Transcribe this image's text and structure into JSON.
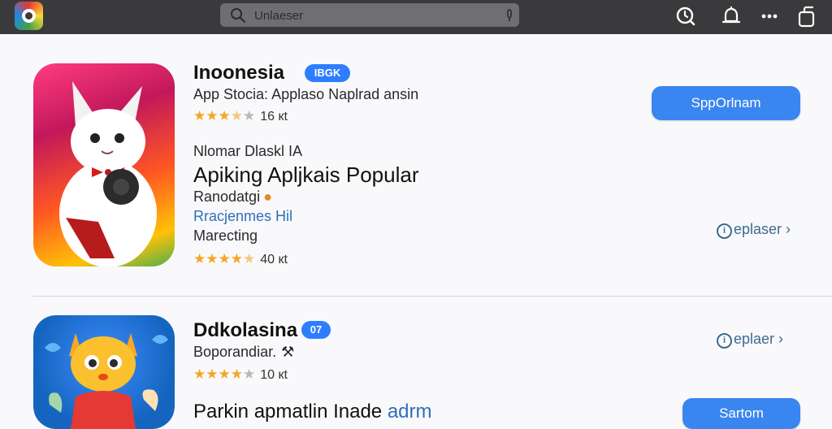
{
  "topbar": {
    "search_placeholder": "Unlaeser",
    "icons": [
      "app-logo",
      "search-icon",
      "mic-icon",
      "history-icon",
      "bell-icon",
      "more-icon",
      "share-icon"
    ]
  },
  "apps": [
    {
      "name": "Inoonesia",
      "badge": "IBGK",
      "subtitle": "App Stocia: Applaso Naplrad ansin",
      "rating": 3.5,
      "rating_count": "16 кt",
      "action_label": "SppOrlnam",
      "section_label": "Nlomar Dlaskl IA",
      "section_title": "Apiking Apljkais Popular",
      "detail_1": "Ranodatgi",
      "detail_link": "Rracjenmes Hil",
      "detail_2": "Marecting",
      "detail_rating": 4.5,
      "detail_rating_count": "40 кt",
      "more_label": "eplaser",
      "icon": "white-cat-mascot-icon"
    },
    {
      "name": "Ddkolasina",
      "badge": "07",
      "subtitle": "Boporandiar.",
      "rating": 4,
      "rating_count": "10 кt",
      "action_label": "Sartom",
      "more_label": "eplaer",
      "section_title": "Parkin apmatlin Inade",
      "section_link": "adrm",
      "icon": "yellow-cat-mascot-icon"
    }
  ],
  "colors": {
    "topbar": "#3a3a3c",
    "accent": "#3a86f0",
    "star": "#f5a623",
    "link": "#3c6b8f"
  }
}
